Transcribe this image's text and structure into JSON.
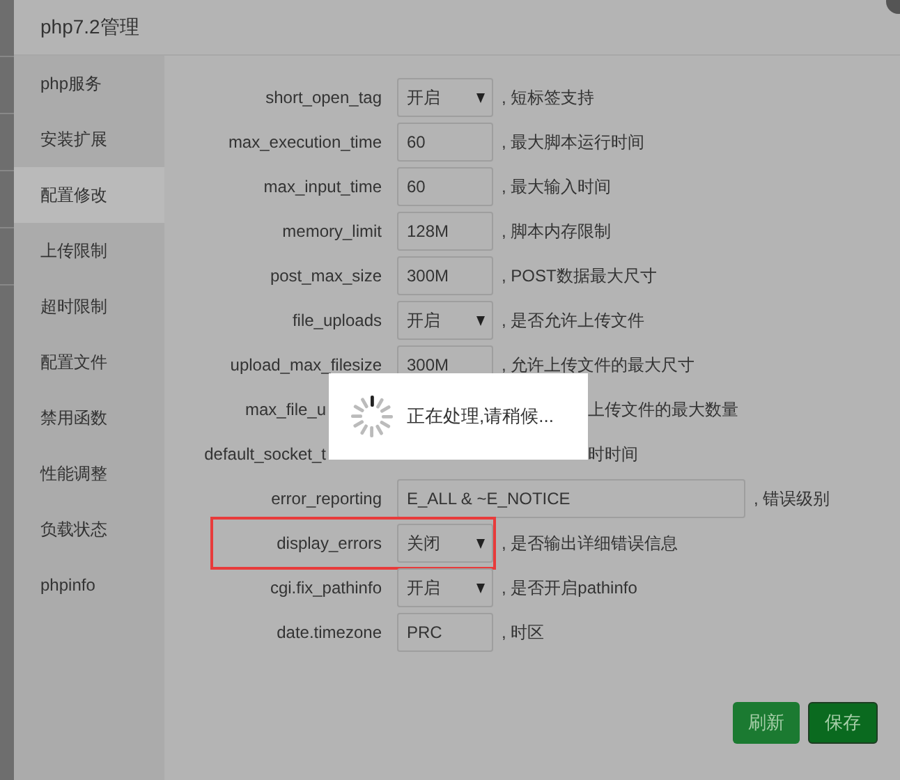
{
  "window": {
    "title": "php7.2管理"
  },
  "sidebar": {
    "items": [
      {
        "label": "php服务",
        "selected": false
      },
      {
        "label": "安装扩展",
        "selected": false
      },
      {
        "label": "配置修改",
        "selected": true
      },
      {
        "label": "上传限制",
        "selected": false
      },
      {
        "label": "超时限制",
        "selected": false
      },
      {
        "label": "配置文件",
        "selected": false
      },
      {
        "label": "禁用函数",
        "selected": false
      },
      {
        "label": "性能调整",
        "selected": false
      },
      {
        "label": "负载状态",
        "selected": false
      },
      {
        "label": "phpinfo",
        "selected": false
      }
    ]
  },
  "settings": [
    {
      "kind": "select",
      "label": "short_open_tag",
      "value": "开启",
      "description": ", 短标签支持",
      "highlighted": false
    },
    {
      "kind": "input",
      "label": "max_execution_time",
      "value": "60",
      "description": ", 最大脚本运行时间",
      "highlighted": false
    },
    {
      "kind": "input",
      "label": "max_input_time",
      "value": "60",
      "description": ", 最大输入时间",
      "highlighted": false
    },
    {
      "kind": "input",
      "label": "memory_limit",
      "value": "128M",
      "description": ", 脚本内存限制",
      "highlighted": false
    },
    {
      "kind": "input",
      "label": "post_max_size",
      "value": "300M",
      "description": ", POST数据最大尺寸",
      "highlighted": false
    },
    {
      "kind": "select",
      "label": "file_uploads",
      "value": "开启",
      "description": ", 是否允许上传文件",
      "highlighted": false
    },
    {
      "kind": "input",
      "label": "upload_max_filesize",
      "value": "300M",
      "description": ", 允许上传文件的最大尺寸",
      "highlighted": false
    },
    {
      "kind": "covered",
      "label": "max_file_u",
      "description": "上传文件的最大数量",
      "highlighted": false
    },
    {
      "kind": "covered",
      "label": "default_socket_t",
      "description": "时时间",
      "highlighted": false
    },
    {
      "kind": "wide",
      "label": "error_reporting",
      "value": "E_ALL & ~E_NOTICE",
      "description": ", 错误级别",
      "highlighted": false
    },
    {
      "kind": "select",
      "label": "display_errors",
      "value": "关闭",
      "description": ", 是否输出详细错误信息",
      "highlighted": true
    },
    {
      "kind": "select",
      "label": "cgi.fix_pathinfo",
      "value": "开启",
      "description": ", 是否开启pathinfo",
      "highlighted": false
    },
    {
      "kind": "input",
      "label": "date.timezone",
      "value": "PRC",
      "description": ", 时区",
      "highlighted": false
    }
  ],
  "buttons": [
    {
      "label": "刷新",
      "kind": "refresh"
    },
    {
      "label": "保存",
      "kind": "save"
    }
  ],
  "loading": {
    "message": "正在处理,请稍候..."
  }
}
